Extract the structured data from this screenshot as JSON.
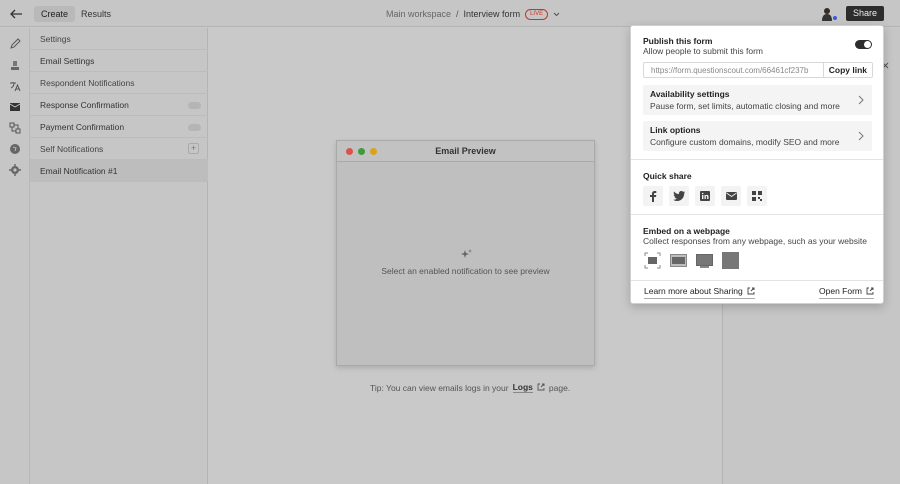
{
  "topbar": {
    "tabs": [
      {
        "label": "Create"
      },
      {
        "label": "Results"
      }
    ],
    "breadcrumb": {
      "workspace": "Main workspace",
      "separator": "/",
      "form_name": "Interview form",
      "status_badge": "LIVE"
    },
    "share_label": "Share"
  },
  "rail": {
    "icons": [
      "edit-icon",
      "layers-icon",
      "translate-icon",
      "mail-icon",
      "integrations-icon",
      "globe-icon",
      "gear-icon"
    ]
  },
  "settings": {
    "rows": [
      {
        "label": "Settings"
      },
      {
        "label": "Email Settings"
      },
      {
        "label": "Respondent Notifications"
      },
      {
        "label": "Response Confirmation"
      },
      {
        "label": "Payment Confirmation"
      },
      {
        "label": "Self Notifications"
      },
      {
        "label": "Email Notification #1"
      }
    ],
    "plus_label": "+"
  },
  "preview": {
    "title": "Email Preview",
    "message": "Select an enabled notification to see preview",
    "traffic_colors": [
      "#d9534f",
      "#3c9b3c",
      "#d9a320"
    ]
  },
  "tip": {
    "prefix": "Tip: You can view emails logs in your",
    "link": "Logs",
    "suffix": "page."
  },
  "share": {
    "publish_title": "Publish this form",
    "publish_desc": "Allow people to submit this form",
    "publish_enabled": true,
    "link_url": "https://form.questionscout.com/66461cf237b",
    "copy_label": "Copy link",
    "availability": {
      "title": "Availability settings",
      "desc": "Pause form, set limits, automatic closing and more"
    },
    "link_options": {
      "title": "Link options",
      "desc": "Configure custom domains, modify SEO and more"
    },
    "quick_share_title": "Quick share",
    "quick_share_icons": [
      "facebook-icon",
      "twitter-icon",
      "linkedin-icon",
      "email-icon",
      "qr-code-icon"
    ],
    "embed_title": "Embed on a webpage",
    "embed_desc": "Collect responses from any webpage, such as your website",
    "embed_icons": [
      "embed-standard-icon",
      "embed-popup-icon",
      "embed-slider-icon",
      "embed-fullpage-icon"
    ],
    "learn_more": "Learn more about Sharing",
    "open_form": "Open Form"
  }
}
